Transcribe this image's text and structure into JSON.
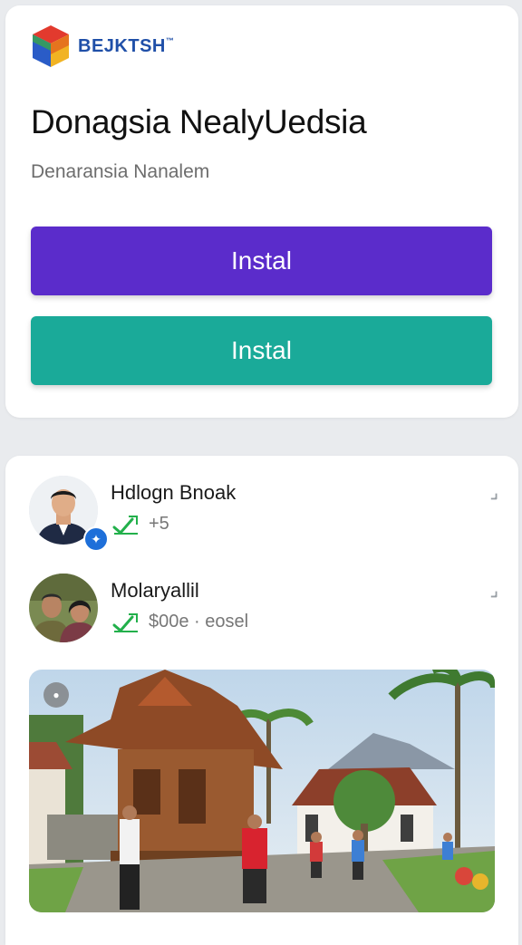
{
  "brand": {
    "name": "BEJKTSH",
    "tm": "™"
  },
  "header": {
    "title": "Donagsia NealyUedsia",
    "subtitle": "Denaransia Nanalem"
  },
  "buttons": {
    "primary": {
      "label": "Instal",
      "color": "#5b2ccb"
    },
    "secondary": {
      "label": "Instal",
      "color": "#1aaa99"
    }
  },
  "people": [
    {
      "name": "Hdlogn Bnoak",
      "meta": "+5",
      "verified": true
    },
    {
      "name": "Molaryallil",
      "meta": "$00e · eosel",
      "verified": false
    }
  ],
  "icons": {
    "check": "check-icon",
    "chevron": "chevron-icon",
    "photo": "photo-icon",
    "verified": "verified-badge-icon"
  },
  "colors": {
    "accent_green": "#22b04b",
    "brand_blue": "#1f4fa8",
    "page_bg": "#e9ebee"
  }
}
